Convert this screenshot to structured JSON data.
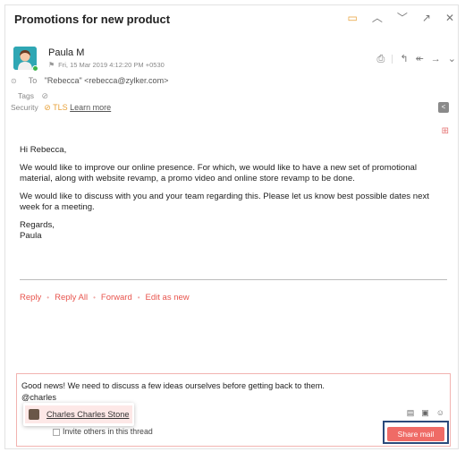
{
  "email": {
    "subject": "Promotions for new product",
    "sender_name": "Paula M",
    "sender_date": "Fri, 15 Mar 2019 4:12:20 PM +0530",
    "to_label": "To",
    "to_value": "\"Rebecca\" <rebecca@zylker.com>",
    "tags_label": "Tags",
    "security_label": "Security",
    "security_tls": "TLS",
    "learn_more": "Learn more",
    "body": {
      "greeting": "Hi Rebecca,",
      "para1": "We would like to improve our online presence. For which, we would like to have a new set of promotional material, along  with website revamp, a promo video and online store revamp to be done.",
      "para2": "We would like to discuss with you and your team regarding this. Please let us know best possible dates next week for a meeting.",
      "signoff1": "Regards,",
      "signoff2": "Paula"
    }
  },
  "reply_links": {
    "reply": "Reply",
    "reply_all": "Reply All",
    "forward": "Forward",
    "edit_as_new": "Edit as new"
  },
  "compose": {
    "line1": "Good news! We need to discuss a few ideas ourselves before getting back to them.",
    "line2": "@charles",
    "invite_text": "Invite others in this thread",
    "share_button": "Share mail"
  },
  "mention": {
    "name": "Charles Charles Stone"
  },
  "colors": {
    "accent": "#e8554e",
    "share_button": "#ef6b66",
    "tls": "#e8a23a",
    "focus_border": "#2b4a7b"
  }
}
